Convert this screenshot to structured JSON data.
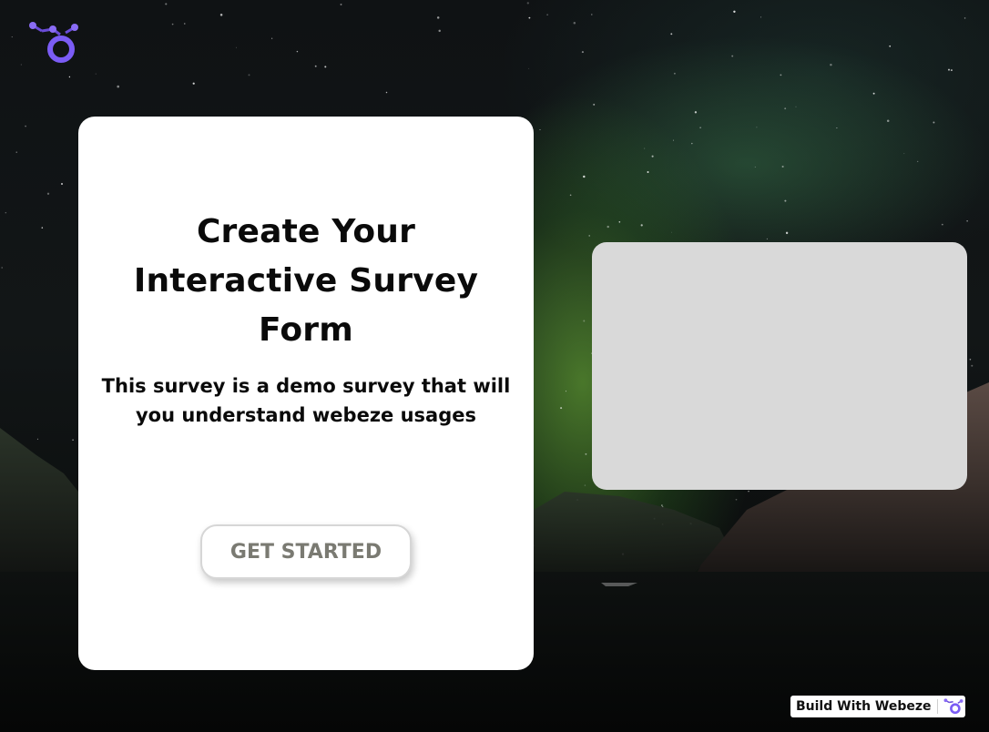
{
  "brand": {
    "logo_icon": "webeze-logo-icon",
    "accent_color": "#7b5cf5"
  },
  "card": {
    "title": "Create Your Interactive Survey Form",
    "subtitle": "This survey is a demo survey that will you understand webeze usages",
    "cta_label": "GET STARTED"
  },
  "media": {
    "placeholder_color": "#d9d9d9"
  },
  "badge": {
    "label": "Build With Webeze",
    "icon": "webeze-logo-icon"
  },
  "background": {
    "scene": "northern-lights-over-mountains"
  }
}
